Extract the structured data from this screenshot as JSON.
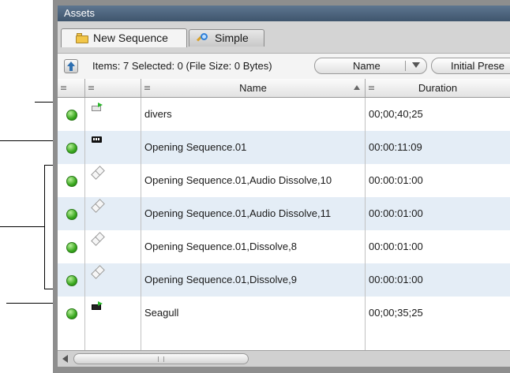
{
  "panel": {
    "title": "Assets"
  },
  "tabs": [
    {
      "label": "New Sequence",
      "icon": "folder-icon",
      "active": true
    },
    {
      "label": "Simple",
      "icon": "magnifier-icon",
      "active": false
    }
  ],
  "toolbar": {
    "items_info": "Items: 7 Selected: 0 (File Size: 0 Bytes)",
    "sort_value": "Name",
    "preset_value": "Initial Prese"
  },
  "columns": [
    {
      "label": ""
    },
    {
      "label": ""
    },
    {
      "label": "Name",
      "sort": "ascending"
    },
    {
      "label": "Duration"
    }
  ],
  "rows": [
    {
      "icon": "sequence-icon",
      "name": "divers",
      "duration": "00;00;40;25",
      "status": "online"
    },
    {
      "icon": "nested-sequence-icon",
      "name": "Opening Sequence.01",
      "duration": "00:00:11:09",
      "status": "online"
    },
    {
      "icon": "transition-icon",
      "name": "Opening Sequence.01,Audio Dissolve,10",
      "duration": "00:00:01:00",
      "status": "online"
    },
    {
      "icon": "transition-icon",
      "name": "Opening Sequence.01,Audio Dissolve,11",
      "duration": "00:00:01:00",
      "status": "online"
    },
    {
      "icon": "transition-icon",
      "name": "Opening Sequence.01,Dissolve,8",
      "duration": "00:00:01:00",
      "status": "online"
    },
    {
      "icon": "transition-icon",
      "name": "Opening Sequence.01,Dissolve,9",
      "duration": "00:00:01:00",
      "status": "online"
    },
    {
      "icon": "sequence-dark-icon",
      "name": "Seagull",
      "duration": "00;00;35;25",
      "status": "online"
    }
  ],
  "colors": {
    "title_bar": "#4a6079",
    "row_alt": "#e4edf6",
    "status_online": "#3aa81f"
  }
}
